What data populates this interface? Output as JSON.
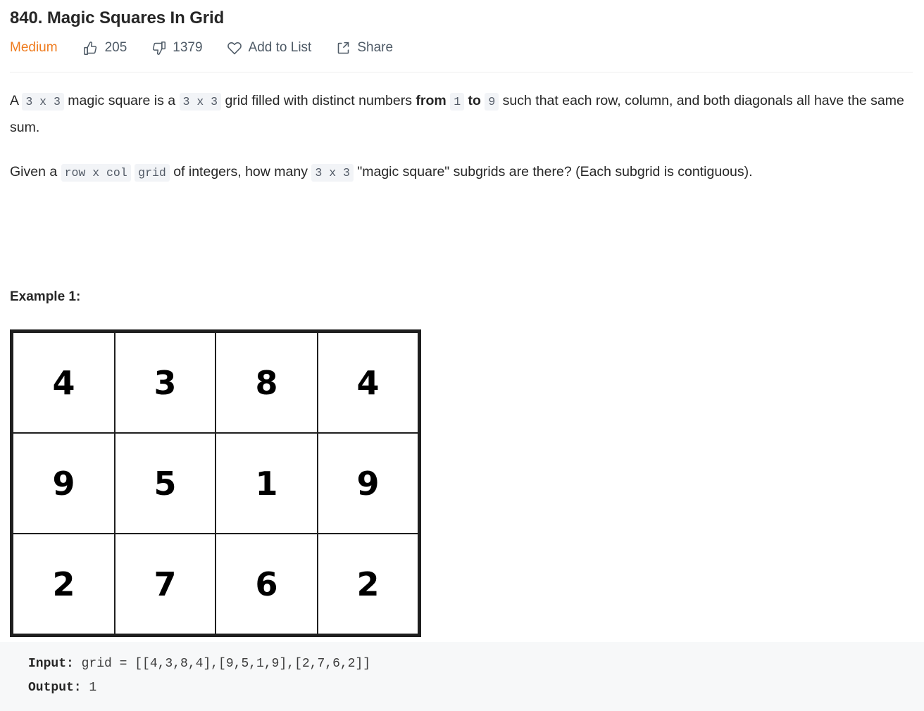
{
  "problem": {
    "title": "840. Magic Squares In Grid",
    "difficulty": "Medium",
    "likes": "205",
    "dislikes": "1379",
    "add_to_list_label": "Add to List",
    "share_label": "Share"
  },
  "icons": {
    "thumbs_up": "thumbs-up-icon",
    "thumbs_down": "thumbs-down-icon",
    "heart": "heart-icon",
    "share": "share-icon"
  },
  "description": {
    "p1": {
      "t1": "A ",
      "c1": "3 x 3",
      "t2": " magic square is a ",
      "c2": "3 x 3",
      "t3": " grid filled with distinct numbers ",
      "b1": "from",
      "t4": " ",
      "c3": "1",
      "t5": " ",
      "b2": "to",
      "t6": " ",
      "c4": "9",
      "t7": " such that each row, column, and both diagonals all have the same sum."
    },
    "p2": {
      "t1": "Given a ",
      "c1": "row x col",
      "t2": " ",
      "c2": "grid",
      "t3": " of integers, how many ",
      "c3": "3 x 3",
      "t4": " \"magic square\" subgrids are there?  (Each subgrid is contiguous)."
    }
  },
  "example": {
    "heading": "Example 1:",
    "grid": [
      [
        "4",
        "3",
        "8",
        "4"
      ],
      [
        "9",
        "5",
        "1",
        "9"
      ],
      [
        "2",
        "7",
        "6",
        "2"
      ]
    ],
    "input_label": "Input:",
    "input_value": " grid = [[4,3,8,4],[9,5,1,9],[2,7,6,2]]",
    "output_label": "Output:",
    "output_value": " 1"
  },
  "colors": {
    "difficulty_medium": "#ef7c1f",
    "text": "#262626",
    "muted": "#4e5a66",
    "code_bg": "#f2f4f7",
    "block_bg": "#f7f8f9",
    "grid_line": "#1f1f1f"
  }
}
